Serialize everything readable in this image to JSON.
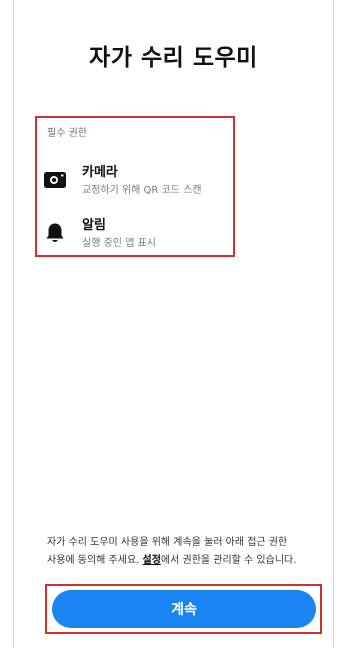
{
  "header": {
    "title": "자가 수리 도우미"
  },
  "permissions": {
    "section_label": "필수 권한",
    "items": [
      {
        "icon": "camera-icon",
        "title": "카메라",
        "description": "교정하기 위해 QR 코드 스캔"
      },
      {
        "icon": "bell-icon",
        "title": "알림",
        "description": "실행 중인 앱 표시"
      }
    ]
  },
  "consent": {
    "line1": "자가 수리 도우미 사용을 위해 계속을 눌러 아래 접근 권한",
    "line2_prefix": "사용에 동의해 주세요. ",
    "settings_link": "설정",
    "line2_suffix": "에서 권한을 관리할 수 있습니다."
  },
  "footer": {
    "continue_label": "계속"
  },
  "colors": {
    "accent": "#1a85f2",
    "highlight": "#d32f2f"
  }
}
